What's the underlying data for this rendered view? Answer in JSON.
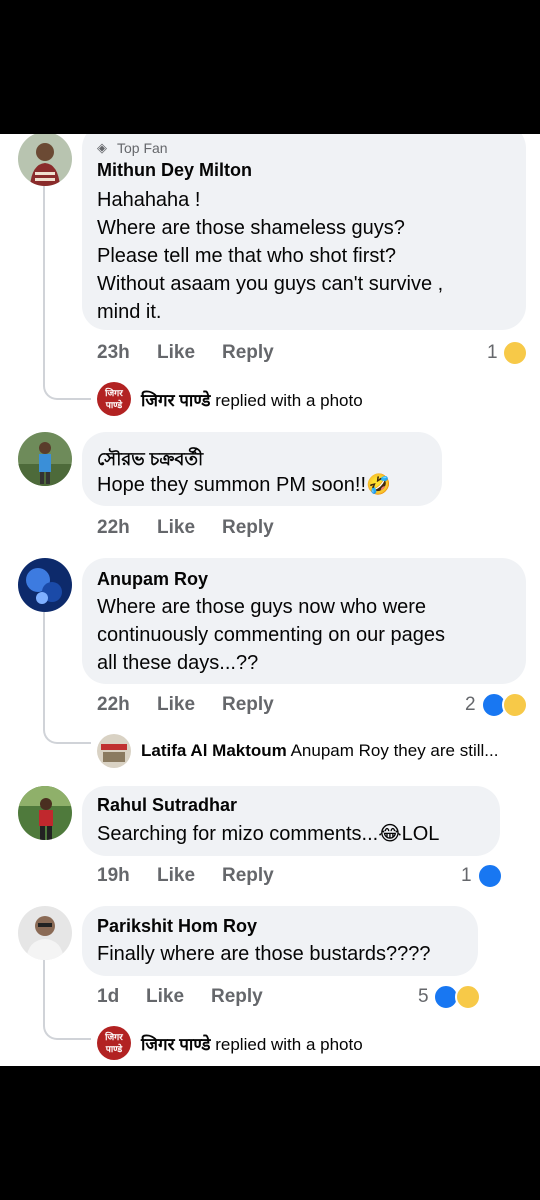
{
  "comments": [
    {
      "badge": "Top Fan",
      "author": "Mithun Dey Milton",
      "text": "Hahahaha !\nWhere are those shameless guys?\nPlease tell me that who shot first?\nWithout asaam you guys can't survive ,\nmind it.",
      "time": "23h",
      "like_label": "Like",
      "reply_label": "Reply",
      "reactions_count": "1",
      "reactions": [
        "haha-emoji"
      ]
    },
    {
      "author": "সৌরভ চক্রবর্তী",
      "text": "Hope they summon PM soon!!🤣",
      "time": "22h",
      "like_label": "Like",
      "reply_label": "Reply"
    },
    {
      "author": "Anupam Roy",
      "text": "Where are those guys now who were\ncontinuously commenting on our pages\nall these days...??",
      "time": "22h",
      "like_label": "Like",
      "reply_label": "Reply",
      "reactions_count": "2",
      "reactions": [
        "like-icon",
        "haha-emoji"
      ]
    },
    {
      "author": "Rahul Sutradhar",
      "text": "Searching for mizo comments...😂LOL",
      "time": "19h",
      "like_label": "Like",
      "reply_label": "Reply",
      "reactions_count": "1",
      "reactions": [
        "like-icon"
      ]
    },
    {
      "author": "Parikshit Hom Roy",
      "text": "Finally where are those bustards????",
      "time": "1d",
      "like_label": "Like",
      "reply_label": "Reply",
      "reactions_count": "5",
      "reactions": [
        "like-icon",
        "haha-emoji"
      ]
    }
  ],
  "replies": [
    {
      "author": "जिगर पाण्डे",
      "snippet": "replied with a photo",
      "avatar_text_top": "जिगर",
      "avatar_text_bottom": "पाण्डे"
    },
    {
      "author": "Latifa Al Maktoum",
      "snippet": "Anupam Roy they are still..."
    },
    {
      "author": "जिगर पाण्डे",
      "snippet": "replied with a photo",
      "avatar_text_top": "जिगर",
      "avatar_text_bottom": "पाण्डे"
    }
  ],
  "colors": {
    "bubble": "#f0f2f5",
    "meta_text": "#65676b",
    "like_blue": "#1877f2",
    "haha_yellow": "#f7c948",
    "jigar_avatar_red": "#b22222"
  }
}
